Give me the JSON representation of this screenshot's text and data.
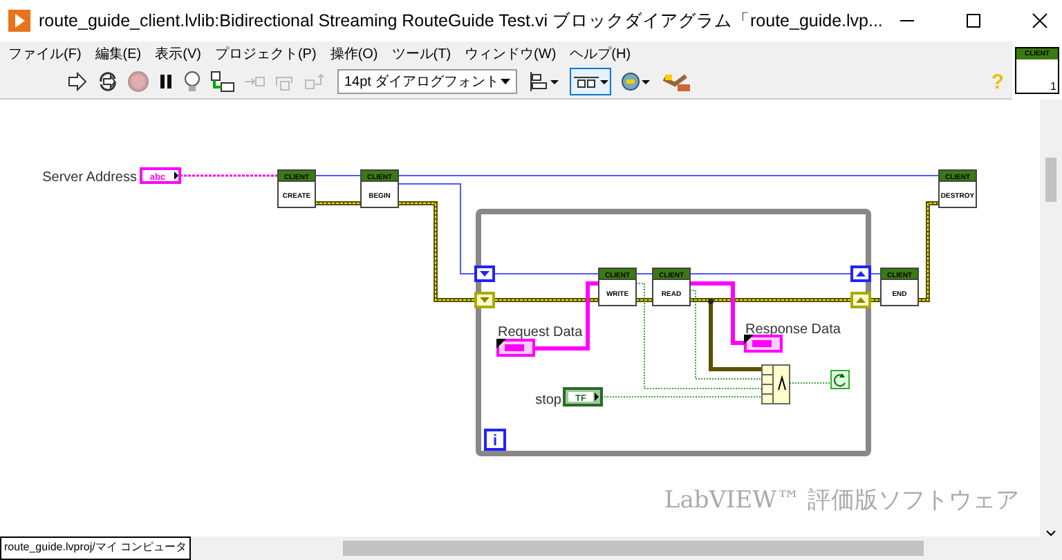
{
  "window": {
    "title": "route_guide_client.lvlib:Bidirectional Streaming RouteGuide Test.vi ブロックダイアグラム「route_guide.lvp..."
  },
  "menu": [
    "ファイル(F)",
    "編集(E)",
    "表示(V)",
    "プロジェクト(P)",
    "操作(O)",
    "ツール(T)",
    "ウィンドウ(W)",
    "ヘルプ(H)"
  ],
  "toolbar": {
    "font": "14pt ダイアログフォント",
    "help": "?"
  },
  "vi_icon": {
    "header": "CLIENT",
    "label": "1"
  },
  "diagram": {
    "nodes": [
      {
        "header": "CLIENT",
        "name": "CREATE"
      },
      {
        "header": "CLIENT",
        "name": "BEGIN"
      },
      {
        "header": "CLIENT",
        "name": "WRITE"
      },
      {
        "header": "CLIENT",
        "name": "READ"
      },
      {
        "header": "CLIENT",
        "name": "END"
      },
      {
        "header": "CLIENT",
        "name": "DESTROY"
      }
    ],
    "terminals": [
      {
        "label": "Server Address",
        "value": "abc"
      },
      {
        "label": "Request Data"
      },
      {
        "label": "Response Data"
      },
      {
        "label": "stop",
        "value": "TF"
      }
    ],
    "iteration": "i",
    "notice": "LabVIEW™ 評価版ソフトウェア"
  },
  "status_bar": {
    "path": "route_guide.lvproj/マイ コンピュータ"
  }
}
